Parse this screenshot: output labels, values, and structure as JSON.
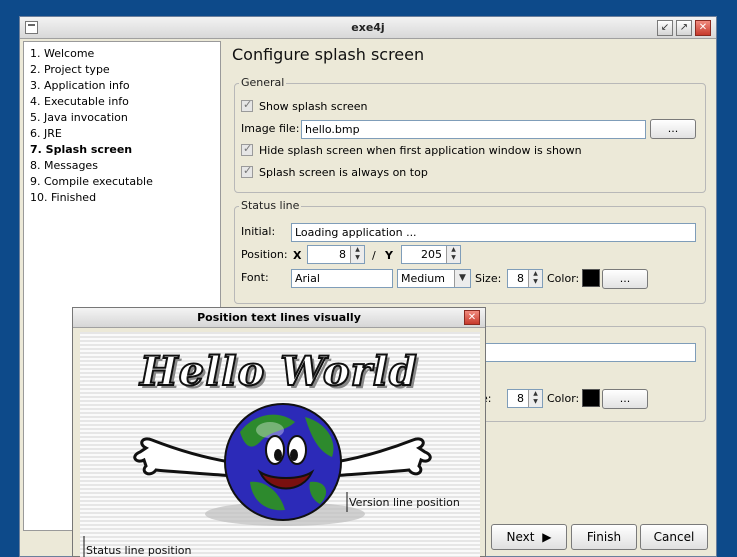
{
  "window": {
    "title": "exe4j"
  },
  "steps": [
    {
      "label": "1. Welcome",
      "active": false
    },
    {
      "label": "2. Project type",
      "active": false
    },
    {
      "label": "3. Application info",
      "active": false
    },
    {
      "label": "4. Executable info",
      "active": false
    },
    {
      "label": "5. Java invocation",
      "active": false
    },
    {
      "label": "6. JRE",
      "active": false
    },
    {
      "label": "7. Splash screen",
      "active": true
    },
    {
      "label": "8. Messages",
      "active": false
    },
    {
      "label": "9. Compile executable",
      "active": false
    },
    {
      "label": "10. Finished",
      "active": false
    }
  ],
  "page": {
    "heading": "Configure splash screen"
  },
  "general": {
    "legend": "General",
    "show_splash": "Show splash screen",
    "image_file_label": "Image file:",
    "image_file_value": "hello.bmp",
    "browse": "...",
    "hide_splash": "Hide splash screen when first application window is shown",
    "always_on_top": "Splash screen is always on top"
  },
  "status_line": {
    "legend": "Status line",
    "initial_label": "Initial:",
    "initial_value": "Loading application ...",
    "position_label": "Position:",
    "x_label": "X",
    "x_value": "8",
    "sep": "/",
    "y_label": "Y",
    "y_value": "205",
    "font_label": "Font:",
    "font_value": "Arial",
    "weight_value": "Medium",
    "size_label": "Size:",
    "size_value": "8",
    "color_label": "Color:",
    "color_button": "..."
  },
  "version_line": {
    "size_label_partial": "e:",
    "size_value": "8",
    "color_label": "Color:",
    "color_button": "..."
  },
  "buttons": {
    "next": "Next",
    "finish": "Finish",
    "cancel": "Cancel"
  },
  "popup": {
    "title": "Position text lines visually",
    "splash_text": "Hello World",
    "version_marker": "Version line position",
    "status_marker": "Status line position"
  }
}
